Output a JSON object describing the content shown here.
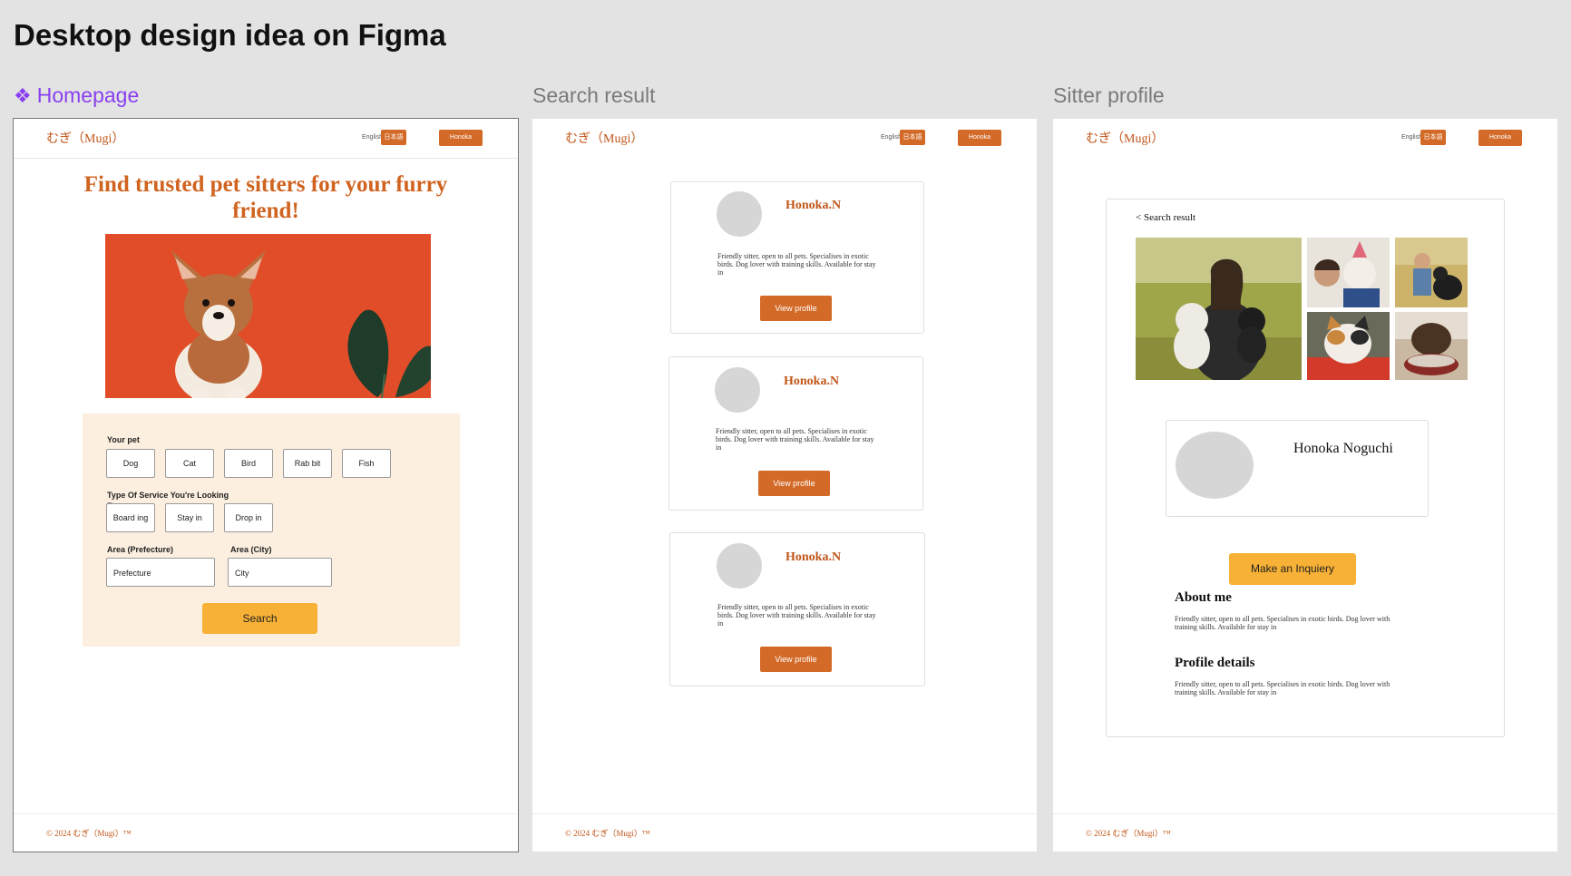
{
  "page_title": "Desktop design idea on Figma",
  "frames": {
    "homepage": {
      "label": "Homepage",
      "component_icon": "component-icon"
    },
    "search": {
      "label": "Search result"
    },
    "profile": {
      "label": "Sitter profile"
    }
  },
  "nav": {
    "logo": "むぎ（Mugi）",
    "lang_english": "English",
    "lang_japanese": "日本語",
    "user_button": "Honoka"
  },
  "footer": {
    "text": "© 2024 むぎ（Mugi）™"
  },
  "homepage": {
    "hero_title": "Find trusted pet sitters for your furry friend!",
    "hero_image_icon": "corgi-puppy-photo",
    "form": {
      "pet_label": "Your pet",
      "pets": [
        "Dog",
        "Cat",
        "Bird",
        "Rab bit",
        "Fish"
      ],
      "service_label": "Type Of Service You're Looking For",
      "services": [
        "Board ing",
        "Stay in",
        "Drop in"
      ],
      "prefecture_label": "Area (Prefecture)",
      "prefecture_placeholder": "Prefecture",
      "city_label": "Area (City)",
      "city_placeholder": "City",
      "search_button": "Search"
    }
  },
  "search_results": {
    "cards": [
      {
        "name": "Honoka.N",
        "bio": "Friendly sitter, open to all pets. Specialises in exotic birds. Dog lover with training skills. Available for stay in",
        "button": "View profile"
      },
      {
        "name": "Honoka.N",
        "bio": "Friendly sitter, open to all pets. Specialises in exotic birds. Dog lover with training skills. Available for stay in",
        "button": "View profile"
      },
      {
        "name": "Honoka.N",
        "bio": "Friendly sitter, open to all pets. Specialises in exotic birds. Dog lover with training skills. Available for stay in",
        "button": "View profile"
      }
    ]
  },
  "profile": {
    "back_link": "<  Search result",
    "full_name": "Honoka Noguchi",
    "inquiry_button": "Make an Inquiery",
    "about_title": "About me",
    "about_text": "Friendly sitter, open to all pets. Specialises in exotic birds. Dog lover with training skills. Available for stay in",
    "details_title": "Profile details",
    "details_text": "Friendly sitter, open to all pets. Specialises in exotic birds. Dog lover with training skills. Available for stay in"
  },
  "colors": {
    "brand_orange": "#d36a27",
    "cta_yellow": "#f7b136",
    "panel_cream": "#fcefdf",
    "figma_selection": "#8a3ff0"
  }
}
